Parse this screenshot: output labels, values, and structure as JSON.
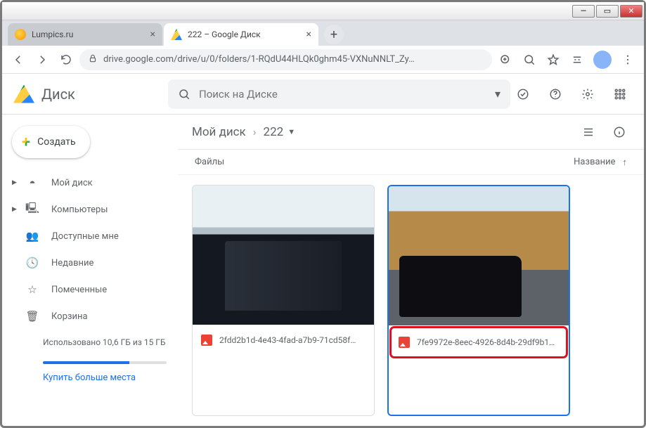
{
  "tabs": [
    {
      "title": "Lumpics.ru"
    },
    {
      "title": "222 – Google Диск"
    }
  ],
  "url": "drive.google.com/drive/u/0/folders/1-RQdU44HLQk0ghm45-VXNuNNLT_Zy…",
  "drive": {
    "name": "Диск"
  },
  "search": {
    "placeholder": "Поиск на Диске"
  },
  "create_label": "Создать",
  "sidebar": {
    "items": [
      {
        "label": "Мой диск"
      },
      {
        "label": "Компьютеры"
      },
      {
        "label": "Доступные мне"
      },
      {
        "label": "Недавние"
      },
      {
        "label": "Помеченные"
      },
      {
        "label": "Корзина"
      }
    ]
  },
  "storage": {
    "text": "Использовано 10,6 ГБ из 15 ГБ"
  },
  "buy_link": "Купить больше места",
  "breadcrumb": {
    "root": "Мой диск",
    "current": "222"
  },
  "sort": {
    "left": "Файлы",
    "right": "Название"
  },
  "files": [
    {
      "name": "2fdd2b1d-4e43-4fad-a7b9-71cd58f…"
    },
    {
      "name": "7fe9972e-8eec-4926-8d4b-29df9b1…"
    }
  ]
}
